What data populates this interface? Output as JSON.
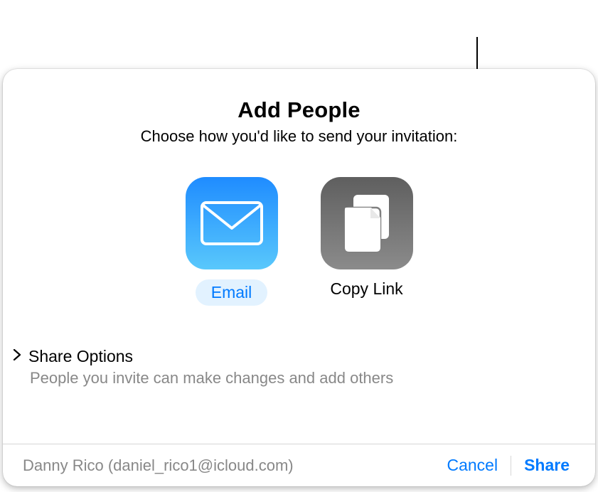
{
  "dialog": {
    "title": "Add People",
    "subtitle": "Choose how you'd like to send your invitation:"
  },
  "options": {
    "email": {
      "label": "Email",
      "selected": true
    },
    "copy_link": {
      "label": "Copy Link",
      "selected": false
    }
  },
  "share_options": {
    "title": "Share Options",
    "description": "People you invite can make changes and add others",
    "expanded": false
  },
  "footer": {
    "user": "Danny Rico (daniel_rico1@icloud.com)",
    "cancel_label": "Cancel",
    "share_label": "Share"
  },
  "colors": {
    "accent": "#007aff",
    "muted": "#888888"
  }
}
